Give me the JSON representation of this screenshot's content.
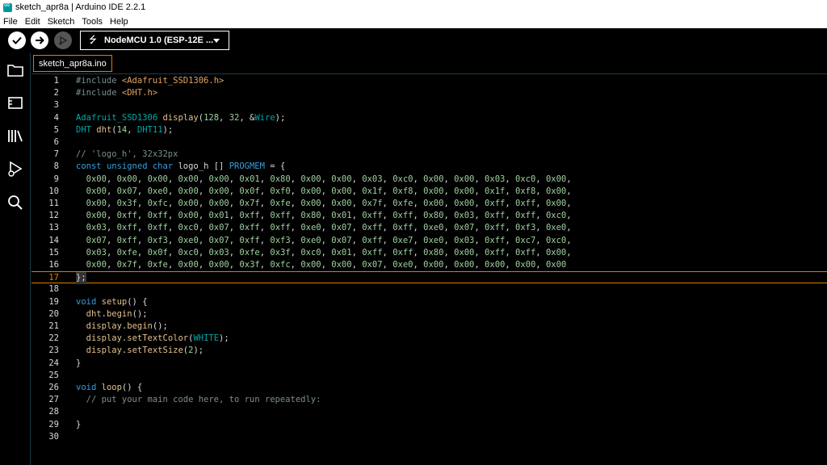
{
  "window": {
    "title": "sketch_apr8a | Arduino IDE 2.2.1"
  },
  "menu": [
    "File",
    "Edit",
    "Sketch",
    "Tools",
    "Help"
  ],
  "toolbar": {
    "board": "NodeMCU 1.0 (ESP-12E ..."
  },
  "tabs": [
    {
      "label": "sketch_apr8a.ino"
    }
  ],
  "colors": {
    "accent": "#e07b00",
    "keyword": "#3a9ed8",
    "type": "#00a8a8",
    "string": "#e2a45f",
    "comment": "#7b8f8f",
    "func": "#e2c08d",
    "number": "#9fd09f"
  },
  "editor": {
    "current_line": 17,
    "lines": [
      {
        "n": "1",
        "t": "#include <Adafruit_SSD1306.h>"
      },
      {
        "n": "2",
        "t": "#include <DHT.h>"
      },
      {
        "n": "3",
        "t": ""
      },
      {
        "n": "4",
        "t": "Adafruit_SSD1306 display(128, 32, &Wire);"
      },
      {
        "n": "5",
        "t": "DHT dht(14, DHT11);"
      },
      {
        "n": "6",
        "t": ""
      },
      {
        "n": "7",
        "t": "// 'logo_h', 32x32px"
      },
      {
        "n": "8",
        "t": "const unsigned char logo_h [] PROGMEM = {"
      },
      {
        "n": "9",
        "t": "  0x00, 0x00, 0x00, 0x00, 0x00, 0x01, 0x80, 0x00, 0x00, 0x03, 0xc0, 0x00, 0x00, 0x03, 0xc0, 0x00,"
      },
      {
        "n": "10",
        "t": "  0x00, 0x07, 0xe0, 0x00, 0x00, 0x0f, 0xf0, 0x00, 0x00, 0x1f, 0xf8, 0x00, 0x00, 0x1f, 0xf8, 0x00,"
      },
      {
        "n": "11",
        "t": "  0x00, 0x3f, 0xfc, 0x00, 0x00, 0x7f, 0xfe, 0x00, 0x00, 0x7f, 0xfe, 0x00, 0x00, 0xff, 0xff, 0x00,"
      },
      {
        "n": "12",
        "t": "  0x00, 0xff, 0xff, 0x00, 0x01, 0xff, 0xff, 0x80, 0x01, 0xff, 0xff, 0x80, 0x03, 0xff, 0xff, 0xc0,"
      },
      {
        "n": "13",
        "t": "  0x03, 0xff, 0xff, 0xc0, 0x07, 0xff, 0xff, 0xe0, 0x07, 0xff, 0xff, 0xe0, 0x07, 0xff, 0xf3, 0xe0,"
      },
      {
        "n": "14",
        "t": "  0x07, 0xff, 0xf3, 0xe0, 0x07, 0xff, 0xf3, 0xe0, 0x07, 0xff, 0xe7, 0xe0, 0x03, 0xff, 0xc7, 0xc0,"
      },
      {
        "n": "15",
        "t": "  0x03, 0xfe, 0x0f, 0xc0, 0x03, 0xfe, 0x3f, 0xc0, 0x01, 0xff, 0xff, 0x80, 0x00, 0xff, 0xff, 0x00,"
      },
      {
        "n": "16",
        "t": "  0x00, 0x7f, 0xfe, 0x00, 0x00, 0x3f, 0xfc, 0x00, 0x00, 0x07, 0xe0, 0x00, 0x00, 0x00, 0x00, 0x00"
      },
      {
        "n": "17",
        "t": "};"
      },
      {
        "n": "18",
        "t": ""
      },
      {
        "n": "19",
        "t": "void setup() {"
      },
      {
        "n": "20",
        "t": "  dht.begin();"
      },
      {
        "n": "21",
        "t": "  display.begin();"
      },
      {
        "n": "22",
        "t": "  display.setTextColor(WHITE);"
      },
      {
        "n": "23",
        "t": "  display.setTextSize(2);"
      },
      {
        "n": "24",
        "t": "}"
      },
      {
        "n": "25",
        "t": ""
      },
      {
        "n": "26",
        "t": "void loop() {"
      },
      {
        "n": "27",
        "t": "  // put your main code here, to run repeatedly:"
      },
      {
        "n": "28",
        "t": ""
      },
      {
        "n": "29",
        "t": "}"
      },
      {
        "n": "30",
        "t": ""
      }
    ]
  }
}
